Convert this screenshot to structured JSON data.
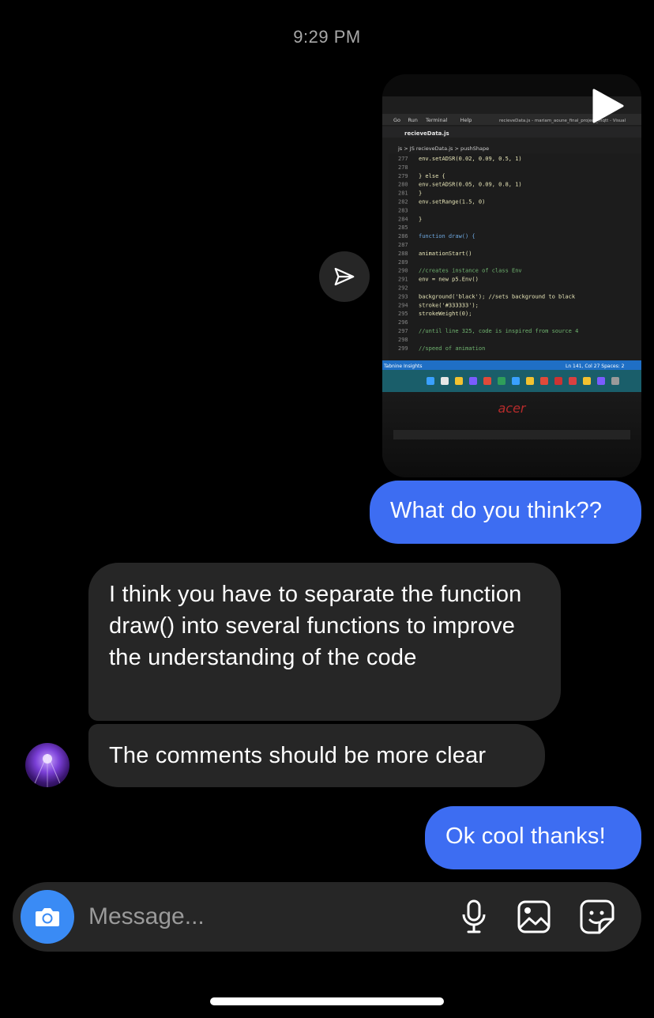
{
  "timestamp": "9:29 PM",
  "video": {
    "menu": [
      "Go",
      "Run",
      "Terminal",
      "Help"
    ],
    "window_title": "recieveData.js - mariam_aoune_final_project_mqtt - Visual",
    "tab": "recieveData.js",
    "breadcrumb": "js > JS recieveData.js > pushShape",
    "code_lines": [
      {
        "n": "277",
        "t": "    env.setADSR(0.02, 0.09, 0.5, 1)"
      },
      {
        "n": "278",
        "t": ""
      },
      {
        "n": "279",
        "t": "  } else {"
      },
      {
        "n": "280",
        "t": "    env.setADSR(0.05, 0.09, 0.8, 1)"
      },
      {
        "n": "281",
        "t": "  }"
      },
      {
        "n": "282",
        "t": "  env.setRange(1.5, 0)"
      },
      {
        "n": "283",
        "t": ""
      },
      {
        "n": "284",
        "t": "}"
      },
      {
        "n": "285",
        "t": ""
      },
      {
        "n": "286",
        "t": "function draw() {"
      },
      {
        "n": "287",
        "t": ""
      },
      {
        "n": "288",
        "t": "  animationStart()"
      },
      {
        "n": "289",
        "t": ""
      },
      {
        "n": "290",
        "t": "  //creates instance of class Env"
      },
      {
        "n": "291",
        "t": "  env = new p5.Env()"
      },
      {
        "n": "292",
        "t": ""
      },
      {
        "n": "293",
        "t": "  background('black'); //sets background to black"
      },
      {
        "n": "294",
        "t": "  stroke('#333333');"
      },
      {
        "n": "295",
        "t": "  strokeWeight(0);"
      },
      {
        "n": "296",
        "t": ""
      },
      {
        "n": "297",
        "t": "  //until line 325, code is inspired from source 4"
      },
      {
        "n": "298",
        "t": ""
      },
      {
        "n": "299",
        "t": "  //speed of animation"
      }
    ],
    "status_left": "Tabnine Insights",
    "status_right": "Ln 141, Col 27   Spaces: 2",
    "brand": "acer"
  },
  "messages": [
    {
      "id": "b1",
      "side": "out",
      "text": "What do you think??"
    },
    {
      "id": "b2",
      "side": "in",
      "text": "I think you have to separate the function draw() into several functions to improve the understanding of the code"
    },
    {
      "id": "b3",
      "side": "in",
      "text": "The comments should be more clear"
    },
    {
      "id": "b4",
      "side": "out",
      "text": "Ok cool thanks!"
    }
  ],
  "composer": {
    "placeholder": "Message..."
  },
  "colors": {
    "outgoing": "#3d6df2",
    "incoming": "#262626",
    "camera": "#3a8bf5"
  },
  "icons": [
    "play-icon",
    "send-icon",
    "camera-icon",
    "microphone-icon",
    "gallery-icon",
    "sticker-icon"
  ]
}
